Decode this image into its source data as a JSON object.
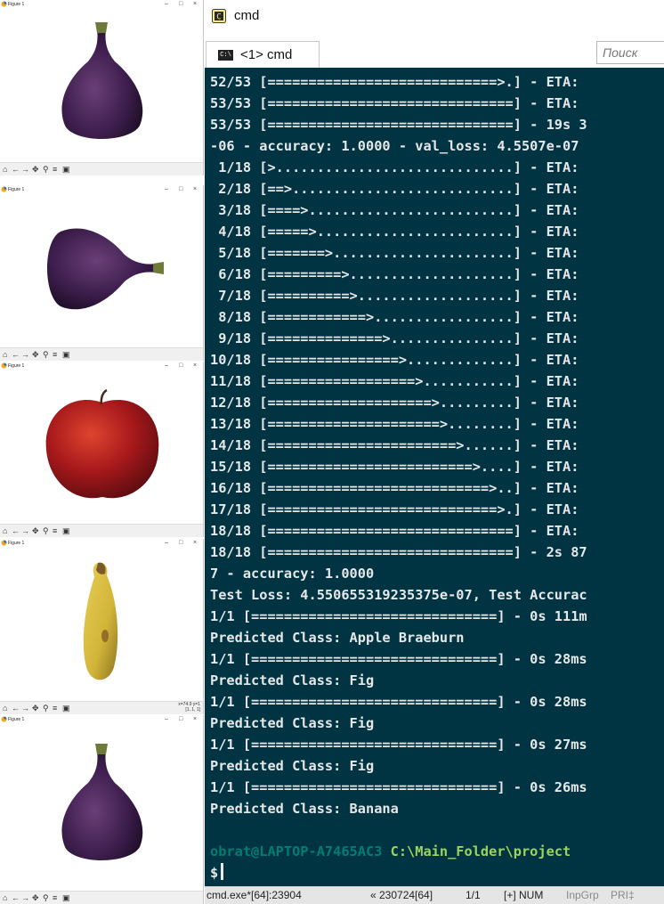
{
  "colors": {
    "console_bg": "#003442",
    "console_text": "#e7e7e7",
    "prompt_user": "#007e74",
    "prompt_path": "#9dd35a",
    "fig_purple": "#3f1f4f",
    "apple_red": "#a5181b",
    "banana_yellow": "#d2b43a"
  },
  "figures": [
    {
      "title": "Figure 1",
      "image": "fig",
      "icon": "fig-fruit-image"
    },
    {
      "title": "Figure 1",
      "image": "fig-sideways",
      "icon": "fig-fruit-image"
    },
    {
      "title": "Figure 1",
      "image": "apple",
      "icon": "apple-fruit-image"
    },
    {
      "title": "Figure 1",
      "image": "banana",
      "icon": "banana-fruit-image",
      "coords": "x=74.9 y=1\n[1, 1, 1]"
    },
    {
      "title": "Figure 1",
      "image": "fig",
      "icon": "fig-fruit-image"
    }
  ],
  "window_controls": {
    "minimize": "–",
    "maximize": "□",
    "close": "×"
  },
  "toolbar_icons": {
    "home": "⌂",
    "back": "←",
    "forward": "→",
    "pan": "✥",
    "zoom": "⚲",
    "configure": "≡",
    "save": "▣"
  },
  "cmd": {
    "title": "cmd",
    "tab_label": "<1> cmd",
    "tab_icon_text": "C:\\",
    "search_placeholder": "Поиск",
    "lines": [
      "52/53 [============================>.] - ETA: ",
      "53/53 [==============================] - ETA: ",
      "53/53 [==============================] - 19s 3",
      "-06 - accuracy: 1.0000 - val_loss: 4.5507e-07",
      " 1/18 [>.............................] - ETA: ",
      " 2/18 [==>...........................] - ETA: ",
      " 3/18 [====>.........................] - ETA: ",
      " 4/18 [=====>........................] - ETA: ",
      " 5/18 [=======>......................] - ETA: ",
      " 6/18 [=========>....................] - ETA: ",
      " 7/18 [==========>...................] - ETA: ",
      " 8/18 [============>.................] - ETA: ",
      " 9/18 [==============>...............] - ETA: ",
      "10/18 [================>.............] - ETA: ",
      "11/18 [==================>...........] - ETA: ",
      "12/18 [====================>.........] - ETA: ",
      "13/18 [=====================>........] - ETA: ",
      "14/18 [=======================>......] - ETA: ",
      "15/18 [=========================>....] - ETA: ",
      "16/18 [===========================>..] - ETA: ",
      "17/18 [============================>.] - ETA: ",
      "18/18 [==============================] - ETA: ",
      "18/18 [==============================] - 2s 87",
      "7 - accuracy: 1.0000",
      "Test Loss: 4.550655319235375e-07, Test Accurac",
      "1/1 [==============================] - 0s 111m",
      "Predicted Class: Apple Braeburn",
      "1/1 [==============================] - 0s 28ms",
      "Predicted Class: Fig",
      "1/1 [==============================] - 0s 28ms",
      "Predicted Class: Fig",
      "1/1 [==============================] - 0s 27ms",
      "Predicted Class: Fig",
      "1/1 [==============================] - 0s 26ms",
      "Predicted Class: Banana"
    ],
    "prompt": {
      "user_host": "obrat@LAPTOP-A7465AC3",
      "path": "C:\\Main_Folder\\project",
      "symbol": "$"
    },
    "status": {
      "process": "cmd.exe*[64]:23904",
      "build": "« 230724[64]",
      "pages": "1/1",
      "flags": "[+] NUM",
      "inpgrp": "InpGrp",
      "pri": "PRI‡"
    }
  }
}
